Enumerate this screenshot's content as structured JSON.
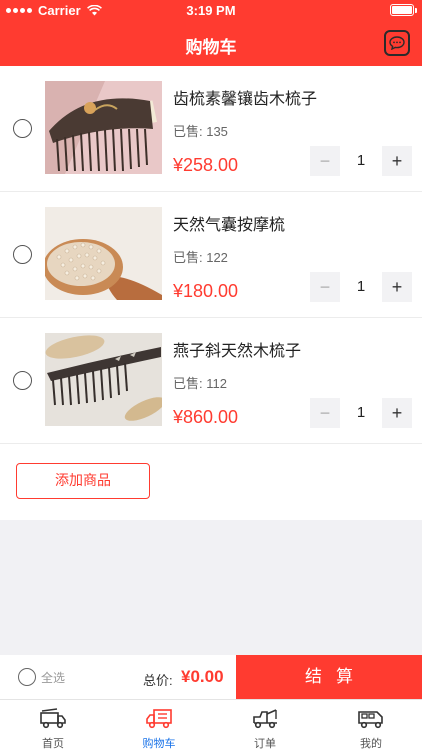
{
  "status_bar": {
    "carrier": "Carrier",
    "time": "3:19 PM"
  },
  "header": {
    "title": "购物车",
    "message_icon": "chat-bubble-icon"
  },
  "cart": {
    "items": [
      {
        "name": "齿梳素馨镶齿木梳子",
        "sold": "已售: 135",
        "price": "¥258.00",
        "quantity": "1"
      },
      {
        "name": "天然气囊按摩梳",
        "sold": "已售: 122",
        "price": "¥180.00",
        "quantity": "1"
      },
      {
        "name": "燕子斜天然木梳子",
        "sold": "已售: 112",
        "price": "¥860.00",
        "quantity": "1"
      }
    ],
    "stepper": {
      "minus": "−",
      "plus": "+"
    },
    "add_button": "添加商品"
  },
  "checkout": {
    "select_all": "全选",
    "total_label": "总价:",
    "total_value": "¥0.00",
    "pay_button": "结算"
  },
  "tabbar": {
    "tabs": [
      {
        "label": "首页",
        "icon": "fire-truck-icon",
        "active": false
      },
      {
        "label": "购物车",
        "icon": "delivery-truck-icon",
        "active": true
      },
      {
        "label": "订单",
        "icon": "tow-truck-icon",
        "active": false
      },
      {
        "label": "我的",
        "icon": "van-icon",
        "active": false
      }
    ]
  },
  "colors": {
    "accent": "#ff3b30",
    "active_tab": "#1a73e8"
  }
}
